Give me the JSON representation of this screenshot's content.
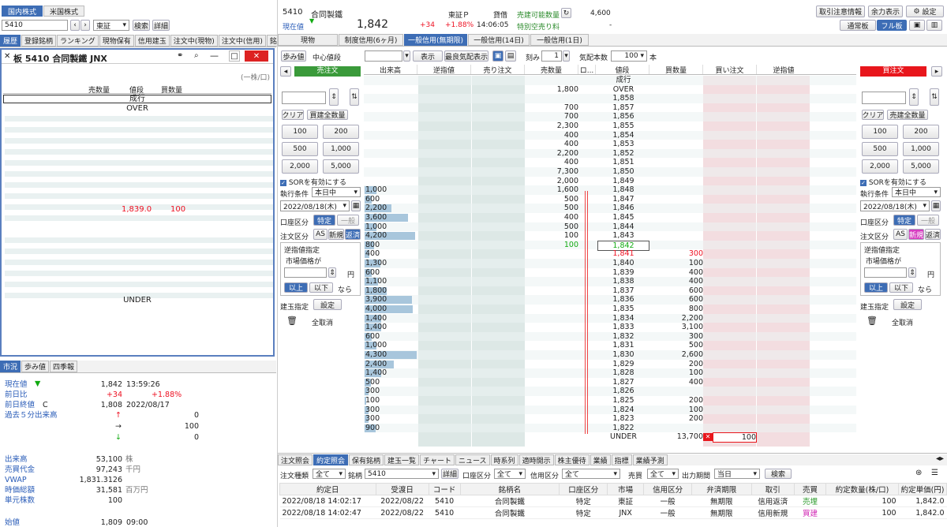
{
  "market_tabs": [
    "国内株式",
    "米国株式"
  ],
  "code_input": "5410",
  "market_select": "東証",
  "search_btn": "検索",
  "detail_btn": "詳細",
  "left_tabs": [
    "履歴",
    "登録銘柄",
    "ランキング",
    "現物保有",
    "信用建玉",
    "注文中(現物)",
    "注文中(信用)",
    "銘"
  ],
  "board": {
    "title": "板 5410 合同製鐵 JNX",
    "unit_note": "(一株/口)",
    "col_sell": "売数量",
    "col_price": "値段",
    "col_buy": "買数量",
    "nari": "成行",
    "over": "OVER",
    "under": "UNDER",
    "price": "1,839.0",
    "qty": "100"
  },
  "info_tabs": [
    "市況",
    "歩み値",
    "四季報"
  ],
  "info": {
    "current_label": "現在値",
    "current_arrow": "▼",
    "current_value": "1,842",
    "current_time": "13:59:26",
    "diff_label": "前日比",
    "diff_value": "+34",
    "diff_pct": "+1.88%",
    "prev_label": "前日終値",
    "prev_mark": "C",
    "prev_value": "1,808",
    "prev_date": "2022/08/17",
    "five_label": "過去５分出来高",
    "up_arrow": "↑",
    "up_val": "0",
    "flat_arrow": "→",
    "flat_val": "100",
    "down_arrow": "↓",
    "down_val": "0",
    "vol_label": "出来高",
    "vol_value": "53,100",
    "vol_unit": "株",
    "turnover_label": "売買代金",
    "turnover_value": "97,243",
    "turnover_unit": "千円",
    "vwap_label": "VWAP",
    "vwap_value": "1,831.3126",
    "cap_label": "時価総額",
    "cap_value": "31,581",
    "cap_unit": "百万円",
    "unit_label": "単元株数",
    "unit_value": "100",
    "open_label": "始値",
    "open_value": "1,809",
    "open_time": "09:00"
  },
  "stock": {
    "code": "5410",
    "name": "合同製鐵",
    "market": "東証Ｐ",
    "margin_type": "貸借",
    "short_label": "売建可能数量",
    "short_value": "4,600",
    "current_label": "現在値",
    "price": "1,842",
    "change": "+34",
    "change_pct": "+1.88%",
    "time": "14:06:05",
    "special_label": "特別空売り料",
    "special_value": "-"
  },
  "top_buttons": [
    "取引注意情報",
    "余力表示",
    "設定"
  ],
  "view_tabs": [
    "通常板",
    "フル板"
  ],
  "order_tabs": [
    "現物",
    "制度信用(6ヶ月)",
    "一般信用(無期限)",
    "一般信用(14日)",
    "一般信用(1日)"
  ],
  "toolbar": {
    "ayumi": "歩み値",
    "center_label": "中心値段",
    "display": "表示",
    "best_display": "最良気配表示",
    "step_label": "刻み",
    "step_value": "1",
    "count_label": "気配本数",
    "count_value": "100",
    "count_unit": "本"
  },
  "sell_panel": {
    "title": "売注文",
    "clear": "クリア",
    "all_btn": "買建全数量",
    "qty_buttons": [
      "100",
      "200",
      "500",
      "1,000",
      "2,000",
      "5,000"
    ],
    "sor": "SORを有効にする",
    "cond_label": "執行条件",
    "cond_value": "本日中",
    "date_value": "2022/08/18(木)",
    "acct_label": "口座区分",
    "acct_on": "特定",
    "acct_off": "一般",
    "order_label": "注文区分",
    "order_opts": [
      "AS",
      "新規",
      "返済"
    ],
    "stop_title": "逆指値指定",
    "market_price": "市場価格が",
    "yen": "円",
    "above": "以上",
    "below": "以下",
    "nara": "なら",
    "pos_label": "建玉指定",
    "pos_btn": "設定",
    "cancel_all": "全取消"
  },
  "buy_panel": {
    "title": "買注文",
    "clear": "クリア",
    "all_btn": "売建全数量",
    "qty_buttons": [
      "100",
      "200",
      "500",
      "1,000",
      "2,000",
      "5,000"
    ],
    "sor": "SORを有効にする",
    "cond_label": "執行条件",
    "cond_value": "本日中",
    "date_value": "2022/08/18(木)",
    "acct_label": "口座区分",
    "acct_on": "特定",
    "acct_off": "一般",
    "order_label": "注文区分",
    "order_opts": [
      "AS",
      "新規",
      "返済"
    ],
    "stop_title": "逆指値指定",
    "market_price": "市場価格が",
    "yen": "円",
    "above": "以上",
    "below": "以下",
    "nara": "なら",
    "pos_label": "建玉指定",
    "pos_btn": "設定",
    "cancel_all": "全取消"
  },
  "ladder": {
    "headers": [
      "出来高",
      "逆指値",
      "売り注文",
      "売数量",
      "ロ...",
      "値段",
      "買数量",
      "買い注文",
      "逆指値"
    ],
    "rows": [
      {
        "vol": "",
        "sell": "",
        "price": "成行",
        "buy": ""
      },
      {
        "vol": "",
        "sell": "1,800",
        "price": "OVER",
        "buy": ""
      },
      {
        "vol": "",
        "sell": "",
        "price": "1,858",
        "buy": ""
      },
      {
        "vol": "",
        "sell": "700",
        "price": "1,857",
        "buy": ""
      },
      {
        "vol": "",
        "sell": "700",
        "price": "1,856",
        "buy": ""
      },
      {
        "vol": "",
        "sell": "2,300",
        "price": "1,855",
        "buy": ""
      },
      {
        "vol": "",
        "sell": "400",
        "price": "1,854",
        "buy": ""
      },
      {
        "vol": "",
        "sell": "400",
        "price": "1,853",
        "buy": ""
      },
      {
        "vol": "",
        "sell": "2,200",
        "price": "1,852",
        "buy": ""
      },
      {
        "vol": "",
        "sell": "400",
        "price": "1,851",
        "buy": ""
      },
      {
        "vol": "",
        "sell": "7,300",
        "price": "1,850",
        "buy": ""
      },
      {
        "vol": "",
        "sell": "2,000",
        "price": "1,849",
        "buy": ""
      },
      {
        "vol": "1,000",
        "sell": "1,600",
        "price": "1,848",
        "buy": ""
      },
      {
        "vol": "600",
        "sell": "500",
        "price": "1,847",
        "buy": ""
      },
      {
        "vol": "2,200",
        "sell": "500",
        "price": "1,846",
        "buy": ""
      },
      {
        "vol": "3,600",
        "sell": "400",
        "price": "1,845",
        "buy": ""
      },
      {
        "vol": "1,000",
        "sell": "500",
        "price": "1,844",
        "buy": ""
      },
      {
        "vol": "4,200",
        "sell": "100",
        "price": "1,843",
        "buy": ""
      },
      {
        "vol": "800",
        "sell": "100",
        "price": "1,842",
        "buy": ""
      },
      {
        "vol": "400",
        "sell": "",
        "price": "1,841",
        "buy": "300"
      },
      {
        "vol": "1,300",
        "sell": "",
        "price": "1,840",
        "buy": "100"
      },
      {
        "vol": "600",
        "sell": "",
        "price": "1,839",
        "buy": "400"
      },
      {
        "vol": "1,100",
        "sell": "",
        "price": "1,838",
        "buy": "400"
      },
      {
        "vol": "1,800",
        "sell": "",
        "price": "1,837",
        "buy": "600"
      },
      {
        "vol": "3,900",
        "sell": "",
        "price": "1,836",
        "buy": "600"
      },
      {
        "vol": "4,000",
        "sell": "",
        "price": "1,835",
        "buy": "800"
      },
      {
        "vol": "1,400",
        "sell": "",
        "price": "1,834",
        "buy": "2,200"
      },
      {
        "vol": "1,400",
        "sell": "",
        "price": "1,833",
        "buy": "3,100"
      },
      {
        "vol": "600",
        "sell": "",
        "price": "1,832",
        "buy": "300"
      },
      {
        "vol": "1,000",
        "sell": "",
        "price": "1,831",
        "buy": "500"
      },
      {
        "vol": "4,300",
        "sell": "",
        "price": "1,830",
        "buy": "2,600"
      },
      {
        "vol": "2,400",
        "sell": "",
        "price": "1,829",
        "buy": "200"
      },
      {
        "vol": "1,400",
        "sell": "",
        "price": "1,828",
        "buy": "100"
      },
      {
        "vol": "500",
        "sell": "",
        "price": "1,827",
        "buy": "400"
      },
      {
        "vol": "300",
        "sell": "",
        "price": "1,826",
        "buy": ""
      },
      {
        "vol": "100",
        "sell": "",
        "price": "1,825",
        "buy": "200"
      },
      {
        "vol": "300",
        "sell": "",
        "price": "1,824",
        "buy": "100"
      },
      {
        "vol": "300",
        "sell": "",
        "price": "1,823",
        "buy": "200"
      },
      {
        "vol": "900",
        "sell": "",
        "price": "1,822",
        "buy": ""
      },
      {
        "vol": "",
        "sell": "",
        "price": "UNDER",
        "buy": "13,700"
      }
    ],
    "my_order_qty": "100"
  },
  "bottom_tabs": [
    "注文照会",
    "約定照会",
    "保有銘柄",
    "建玉一覧",
    "チャート",
    "ニュース",
    "時系列",
    "適時開示",
    "株主優待",
    "業績",
    "指標",
    "業績予測"
  ],
  "filter": {
    "type_label": "注文種類",
    "type_value": "全て",
    "code_label": "銘柄",
    "code_value": "5410",
    "detail": "詳細",
    "acct_label": "口座区分",
    "acct_value": "全て",
    "credit_label": "信用区分",
    "credit_value": "全て",
    "side_label": "売買",
    "side_value": "全て",
    "period_label": "出力期間",
    "period_value": "当日",
    "search": "検索"
  },
  "exec_table": {
    "headers": [
      "約定日",
      "受渡日",
      "コード",
      "銘柄名",
      "口座区分",
      "市場",
      "信用区分",
      "弁済期限",
      "取引",
      "売買",
      "約定数量(株/口)",
      "約定単価(円)"
    ],
    "rows": [
      [
        "2022/08/18 14:02:17",
        "2022/08/22",
        "5410",
        "合同製鐵",
        "特定",
        "東証",
        "一般",
        "無期限",
        "信用返済",
        "売埋",
        "100",
        "1,842.0"
      ],
      [
        "2022/08/18 14:02:47",
        "2022/08/22",
        "5410",
        "合同製鐵",
        "特定",
        "JNX",
        "一般",
        "無期限",
        "信用新規",
        "買建",
        "100",
        "1,842.0"
      ]
    ]
  },
  "colors": {
    "accent": "#3d6db5",
    "sell_green": "#3a9a3a",
    "buy_red": "#e8161c",
    "bid_pink": "#f3dde0",
    "ask_gray": "#dde8e6",
    "vol_bar": "#a8c6dc"
  }
}
